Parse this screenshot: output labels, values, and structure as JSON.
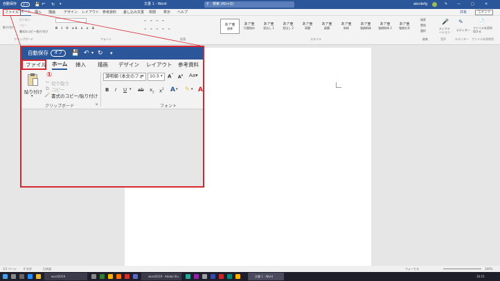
{
  "title": {
    "autosave": "自動保存",
    "toggle": "オフ",
    "doc_title": "文書 1 - Word",
    "search": "検索 (Alt+Q)",
    "user": "abcdefg"
  },
  "tabs": [
    "ファイル",
    "ホーム",
    "挿入",
    "描画",
    "デザイン",
    "レイアウト",
    "参考資料",
    "差し込み文書",
    "校閲",
    "表示",
    "ヘルプ"
  ],
  "right_buttons": {
    "share": "共有",
    "comment": "コメント"
  },
  "ribbon_small": {
    "paste": "貼り付け",
    "cut": "切り取り",
    "copy": "コピー",
    "painter": "書式のコピー/貼り付け",
    "find": "検索",
    "replace": "置換",
    "select": "選択",
    "dictate": "ディクテーション",
    "editor": "エディター",
    "reuse": "ファイルを再利用する",
    "groups": {
      "clipboard": "クリップボード",
      "font": "フォント",
      "paragraph": "段落",
      "styles": "スタイル",
      "edit": "編集",
      "voice": "音声",
      "editor": "エディター",
      "reuse": "ファイルを再利用"
    }
  },
  "styles": [
    {
      "sample": "あア亜",
      "name": "標準"
    },
    {
      "sample": "あア亜",
      "name": "行間詰め"
    },
    {
      "sample": "あア亜",
      "name": "見出し 1"
    },
    {
      "sample": "あア亜",
      "name": "見出し 2"
    },
    {
      "sample": "あア亜",
      "name": "表題"
    },
    {
      "sample": "あア亜",
      "name": "副題"
    },
    {
      "sample": "あア亜",
      "name": "斜体"
    },
    {
      "sample": "あア亜",
      "name": "強調斜体"
    },
    {
      "sample": "あア亜",
      "name": "強調斜体 2"
    },
    {
      "sample": "あア亜",
      "name": "強調太字"
    }
  ],
  "statusbar": {
    "page": "1/1 ページ",
    "words": "0 文字",
    "lang": "日本語",
    "focus": "フォーカス",
    "zoom": "100%"
  },
  "taskbar": {
    "task1": "word2019",
    "task2": "word2019 - Adobe Illu",
    "task3": "文書 1 - Word",
    "time": "10:15"
  },
  "zoom": {
    "autosave": "自動保存",
    "toggle": "オフ",
    "tabs": [
      "ファイル",
      "ホーム",
      "挿入",
      "描画",
      "デザイン",
      "レイアウト",
      "参考資料"
    ],
    "callout": "①",
    "paste": "貼り付け",
    "cut": "切り取り",
    "copy": "コピー",
    "painter": "書式のコピー/貼り付け",
    "font_name": "游明朝 (本文のフォ",
    "font_size": "10.5",
    "group_clipboard": "クリップボード",
    "group_font": "フォント"
  },
  "colors": {
    "accent": "#2b579a",
    "highlight": "#d6262f"
  }
}
